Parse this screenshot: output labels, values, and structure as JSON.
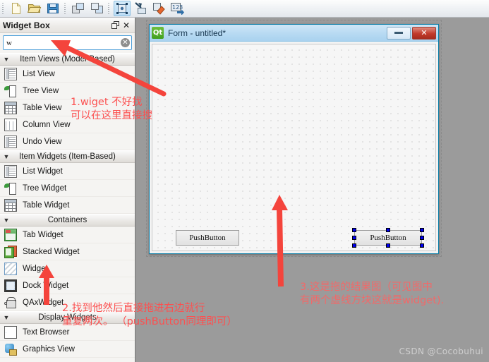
{
  "toolbar": {
    "groups": [
      {
        "name": "file",
        "buttons": [
          {
            "name": "new-form-button",
            "icon": "new-document-icon"
          },
          {
            "name": "open-form-button",
            "icon": "open-folder-icon"
          },
          {
            "name": "save-form-button",
            "icon": "floppy-save-icon"
          }
        ]
      },
      {
        "name": "edit",
        "buttons": [
          {
            "name": "undo-button",
            "icon": "undo-arrow-icon"
          },
          {
            "name": "redo-button",
            "icon": "redo-arrow-icon"
          }
        ]
      },
      {
        "name": "mode",
        "buttons": [
          {
            "name": "edit-widgets-button",
            "icon": "edit-widgets-icon",
            "selected": true
          },
          {
            "name": "edit-signals-slots-button",
            "icon": "signals-slots-icon",
            "selected": false
          },
          {
            "name": "edit-buddies-button",
            "icon": "buddies-tag-icon",
            "selected": false
          },
          {
            "name": "edit-tab-order-button",
            "icon": "tab-order-123-icon",
            "selected": false
          }
        ]
      }
    ]
  },
  "widget_box": {
    "title": "Widget Box",
    "float_icon": "restore-dock-icon",
    "close_icon": "close-x-icon",
    "search": {
      "value": "w",
      "placeholder": "",
      "clear_icon": "clear-circle-icon"
    },
    "groups": [
      {
        "label": "Item Views (Model-Based)",
        "collapse_icon": "chevron-down-icon",
        "items": [
          {
            "label": "List View",
            "icon": "list-view-icon"
          },
          {
            "label": "Tree View",
            "icon": "tree-view-icon"
          },
          {
            "label": "Table View",
            "icon": "table-view-icon"
          },
          {
            "label": "Column View",
            "icon": "column-view-icon"
          },
          {
            "label": "Undo View",
            "icon": "undo-view-icon"
          }
        ]
      },
      {
        "label": "Item Widgets (Item-Based)",
        "collapse_icon": "chevron-down-icon",
        "items": [
          {
            "label": "List Widget",
            "icon": "list-view-icon"
          },
          {
            "label": "Tree Widget",
            "icon": "tree-view-icon"
          },
          {
            "label": "Table Widget",
            "icon": "table-view-icon"
          }
        ]
      },
      {
        "label": "Containers",
        "collapse_icon": "chevron-down-icon",
        "items": [
          {
            "label": "Tab Widget",
            "icon": "tab-widget-icon"
          },
          {
            "label": "Stacked Widget",
            "icon": "stacked-widget-icon"
          },
          {
            "label": "Widget",
            "icon": "widget-icon"
          },
          {
            "label": "Dock Widget",
            "icon": "dock-widget-icon"
          },
          {
            "label": "QAxWidget",
            "icon": "qax-widget-icon"
          }
        ]
      },
      {
        "label": "Display Widgets",
        "collapse_icon": "chevron-down-icon",
        "items": [
          {
            "label": "Text Browser",
            "icon": "text-browser-icon"
          },
          {
            "label": "Graphics View",
            "icon": "graphics-view-icon"
          }
        ]
      }
    ]
  },
  "form_window": {
    "logo_text": "Qt",
    "title": "Form - untitled*",
    "minimize_icon": "minimize-icon",
    "close_icon": "close-x-icon",
    "buttons": [
      {
        "name": "pushbutton-1",
        "label": "PushButton",
        "selected": false
      },
      {
        "name": "pushbutton-2",
        "label": "PushButton",
        "selected": true
      }
    ]
  },
  "annotations": [
    {
      "id": "anno1",
      "lines": [
        "1.wiget 不好找",
        "可以在这里直接搜"
      ],
      "color": "#fc5050"
    },
    {
      "id": "anno2",
      "lines": [
        "2.找到他然后直接拖进右边就行",
        "重复两次。 （pushButton同理即可）"
      ],
      "color": "#fc5050"
    },
    {
      "id": "anno3",
      "lines": [
        "3.这是拖的结果图（可见图中",
        "有两个虚线方块这就是widget)."
      ],
      "color": "#f06a6a"
    }
  ],
  "watermark": "CSDN @Cocobuhui"
}
